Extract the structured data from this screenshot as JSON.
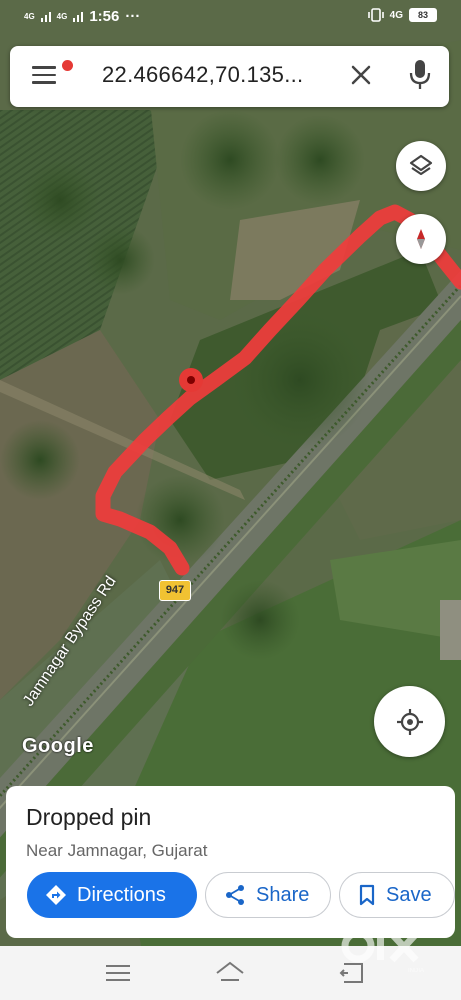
{
  "status_bar": {
    "time": "1:56",
    "net_label_1": "4G",
    "net_label_2": "4G",
    "net_label_right": "4G",
    "more": "···",
    "battery": "83"
  },
  "search": {
    "query": "22.466642,70.135...",
    "menu_icon": "hamburger-menu-icon",
    "clear_icon": "close-icon",
    "mic_icon": "mic-icon"
  },
  "map": {
    "route_color": "#f03c3c",
    "pin_color": "#c62828",
    "highway_shield": "947",
    "road_label": "Jamnagar Bypass Rd",
    "attribution": "Google"
  },
  "place": {
    "title": "Dropped pin",
    "subtitle": "Near Jamnagar, Gujarat"
  },
  "actions": {
    "directions": "Directions",
    "share": "Share",
    "save": "Save"
  },
  "watermark": {
    "text": "olx",
    "subtext": "INDIA"
  },
  "colors": {
    "primary": "#1a73e8",
    "text_dark": "#222222",
    "text_muted": "#666666"
  }
}
